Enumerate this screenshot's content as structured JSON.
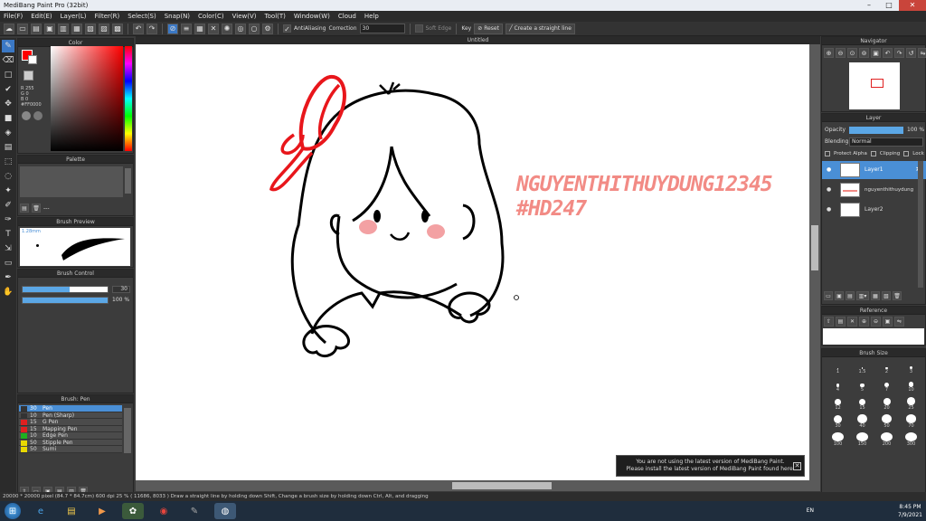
{
  "window": {
    "title": "MediBang Paint Pro (32bit)"
  },
  "menu": [
    "File(F)",
    "Edit(E)",
    "Layer(L)",
    "Filter(R)",
    "Select(S)",
    "Snap(N)",
    "Color(C)",
    "View(V)",
    "Tool(T)",
    "Window(W)",
    "Cloud",
    "Help"
  ],
  "toolbar": {
    "antialiasing": "AntiAliasing",
    "correction_label": "Correction",
    "correction_value": "30",
    "soft_edge": "Soft Edge",
    "key": "Key",
    "reset": "Reset",
    "straight_line": "Create a straight line"
  },
  "color_panel": {
    "title": "Color",
    "readout": [
      "R 255",
      "G 0",
      "B 0",
      "#FF0000"
    ],
    "current_color": "#ff0000"
  },
  "palette": {
    "title": "Palette",
    "footer": "---"
  },
  "brush_preview": {
    "title": "Brush Preview",
    "size_label": "1.28mm"
  },
  "brush_control": {
    "title": "Brush Control",
    "size_value": "30",
    "size_fraction": 0.55,
    "opacity_value": "100 %",
    "opacity_fraction": 1.0
  },
  "brush_list": {
    "title": "Brush: Pen",
    "items": [
      {
        "size": "30",
        "name": "Pen",
        "color": "#333333"
      },
      {
        "size": "10",
        "name": "Pen (Sharp)",
        "color": "#333333"
      },
      {
        "size": "15",
        "name": "G Pen",
        "color": "#e02020"
      },
      {
        "size": "15",
        "name": "Mapping Pen",
        "color": "#e02020"
      },
      {
        "size": "10",
        "name": "Edge Pen",
        "color": "#20b020"
      },
      {
        "size": "50",
        "name": "Stipple Pen",
        "color": "#e8d800"
      },
      {
        "size": "50",
        "name": "Sumi",
        "color": "#e8d800"
      }
    ]
  },
  "canvas": {
    "tab": "Untitled"
  },
  "watermark": {
    "line1": "NGUYENTHITHUYDUNG12345",
    "line2": "#HD247"
  },
  "notice": {
    "line1": "You are not using the latest version of MediBang Paint.",
    "line2": "Please install the latest version of MediBang Paint found here.",
    "close": "✕"
  },
  "navigator": {
    "title": "Navigator"
  },
  "layer_panel": {
    "title": "Layer",
    "opacity_label": "Opacity",
    "opacity_value": "100 %",
    "opacity_fraction": 1.0,
    "blending_label": "Blending",
    "blending_value": "Normal",
    "protect_alpha": "Protect Alpha",
    "clipping": "Clipping",
    "lock": "Lock",
    "layers": [
      "Layer1",
      "nguyenthithuydung",
      "Layer2"
    ]
  },
  "reference": {
    "title": "Reference"
  },
  "brush_size": {
    "title": "Brush Size",
    "sizes": [
      "1",
      "1.5",
      "2",
      "3",
      "4",
      "5",
      "7",
      "10",
      "12",
      "15",
      "20",
      "25",
      "30",
      "40",
      "50",
      "70",
      "100",
      "150",
      "200",
      "300"
    ]
  },
  "status": {
    "text": "20000 * 20000 pixel  (84.7 * 84.7cm)  600 dpi  25 %  ( 11686, 8033 )  Draw a straight line by holding down Shift, Change a brush size by holding down Ctrl, Alt, and dragging"
  },
  "tray": {
    "lang": "EN",
    "time": "8:45 PM",
    "date": "7/9/2021"
  }
}
